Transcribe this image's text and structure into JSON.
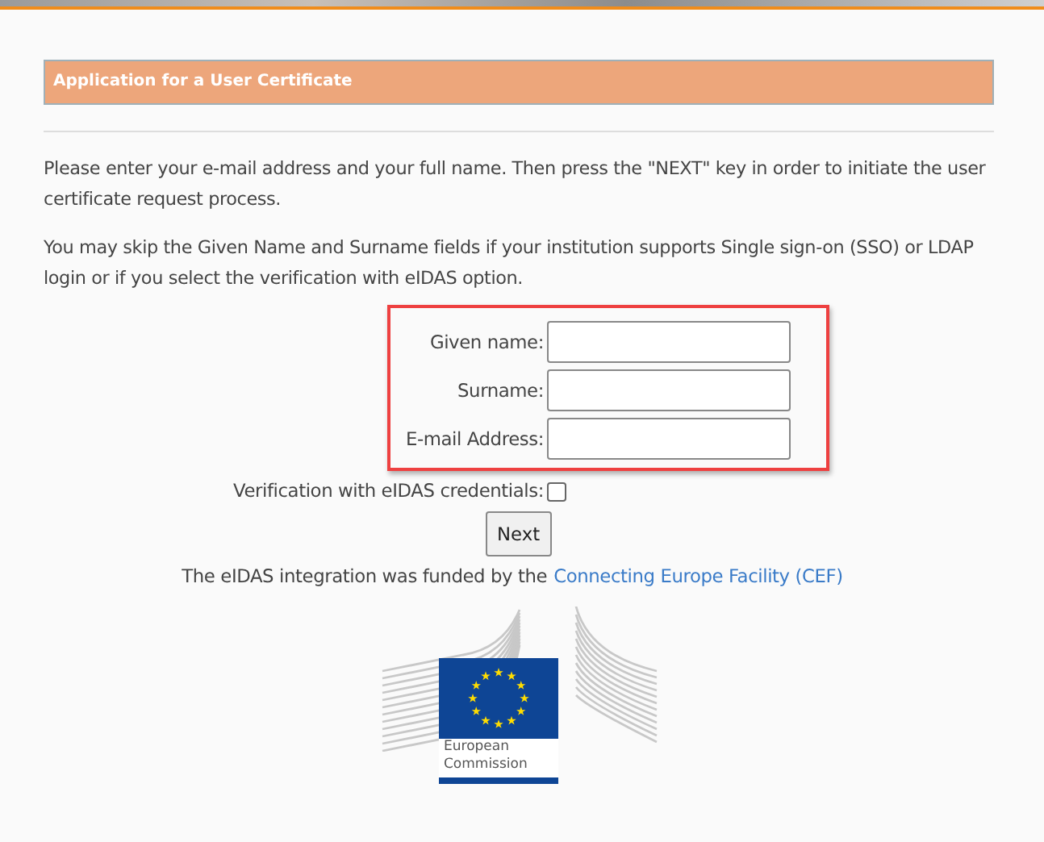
{
  "header": {
    "title": "Application for a User Certificate"
  },
  "paragraphs": [
    "Please enter your e-mail address and your full name. Then press the \"NEXT\" key in order to initiate the user certificate request process.",
    "You may skip the Given Name and Surname fields if your institution supports Single sign-on (SSO) or LDAP login or if you select the verification with eIDAS option."
  ],
  "fields": [
    {
      "label": "Given name:",
      "kind": "text"
    },
    {
      "label": "Surname:",
      "kind": "text"
    },
    {
      "label": "E-mail Address:",
      "kind": "text"
    },
    {
      "label": "Verification with eIDAS credentials:",
      "kind": "checkbox",
      "checked": false
    }
  ],
  "submit": "Next",
  "funding": {
    "text": "The eIDAS integration was funded by the",
    "link": "Connecting Europe Facility (CEF)"
  },
  "logo": {
    "line_1": "European",
    "line_2": "Commission"
  }
}
